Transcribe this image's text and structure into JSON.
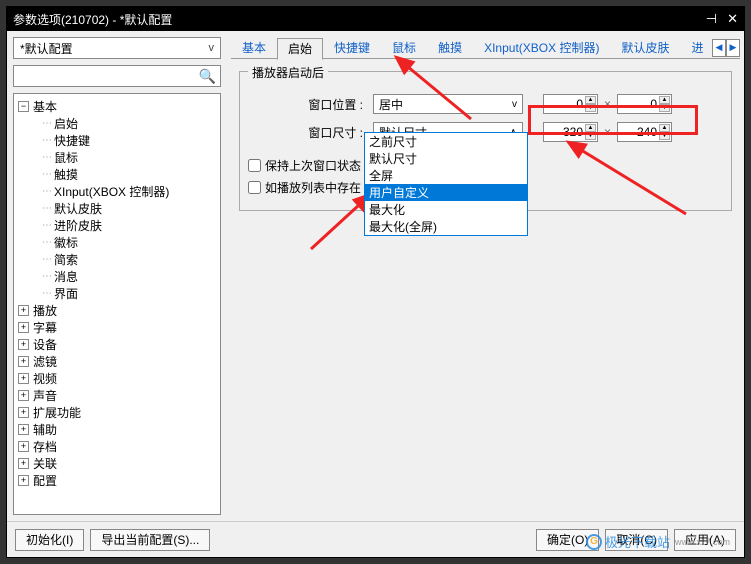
{
  "title": "参数选项(210702) - *默认配置",
  "profile_combo": "*默认配置",
  "tree": {
    "root": "基本",
    "children": [
      "启始",
      "快捷键",
      "鼠标",
      "触摸",
      "XInput(XBOX 控制器)",
      "默认皮肤",
      "进阶皮肤",
      "徽标",
      "简索",
      "消息",
      "界面"
    ],
    "siblings": [
      "播放",
      "字幕",
      "设备",
      "滤镜",
      "视频",
      "声音",
      "扩展功能",
      "辅助",
      "存档",
      "关联",
      "配置"
    ]
  },
  "tabs": {
    "items": [
      "基本",
      "启始",
      "快捷键",
      "鼠标",
      "触摸",
      "XInput(XBOX 控制器)",
      "默认皮肤",
      "进"
    ],
    "active": 1
  },
  "group_title": "播放器启动后",
  "labels": {
    "position": "窗口位置 :",
    "size": "窗口尺寸 :"
  },
  "position": {
    "value": "居中",
    "x": "0",
    "y": "0"
  },
  "size": {
    "value": "默认尺寸",
    "w": "320",
    "h": "240"
  },
  "dropdown": {
    "items": [
      "之前尺寸",
      "默认尺寸",
      "全屏",
      "用户自定义",
      "最大化",
      "最大化(全屏)"
    ],
    "selected": 3
  },
  "checks": {
    "keep": "保持上次窗口状态",
    "playlist": "如播放列表中存在"
  },
  "buttons": {
    "init": "初始化(I)",
    "export": "导出当前配置(S)...",
    "ok": "确定(O)",
    "cancel": "取消(C)",
    "apply": "应用(A)"
  },
  "watermark": {
    "text": "极光下载站",
    "url": "www.xz7.com"
  }
}
